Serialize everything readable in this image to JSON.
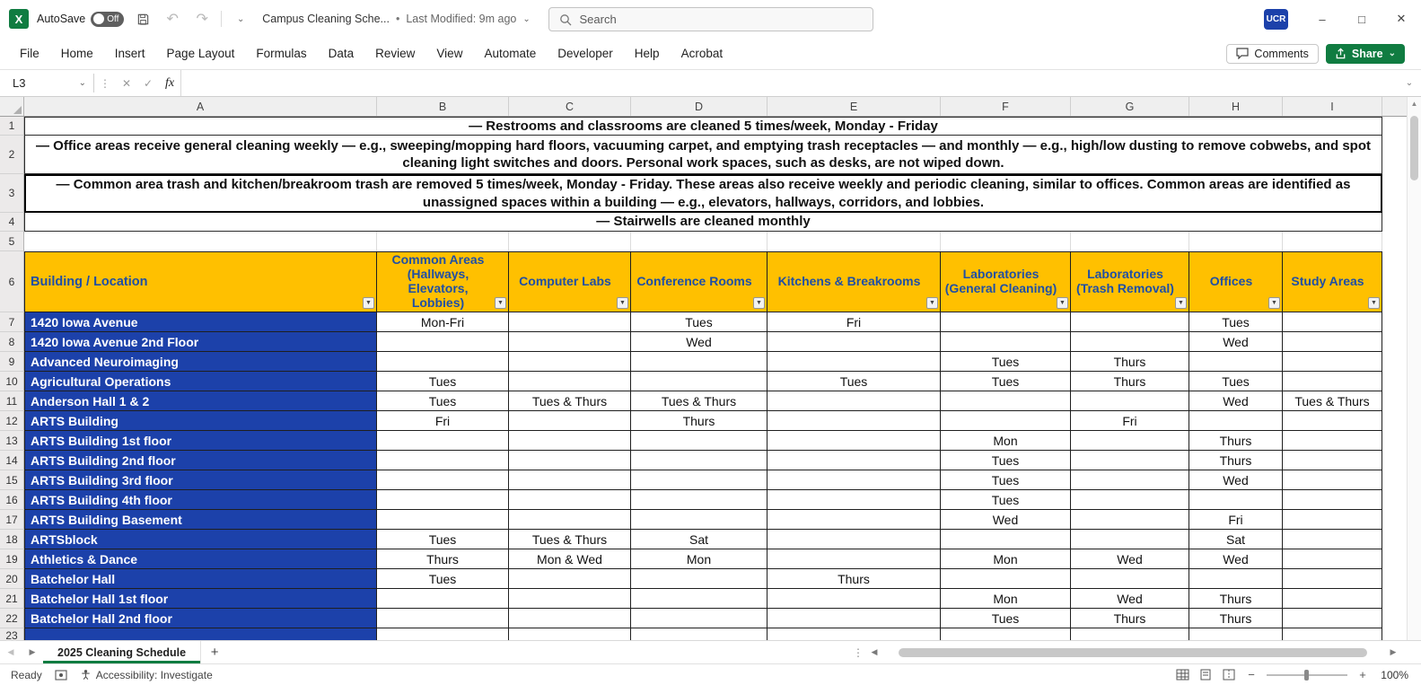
{
  "colors": {
    "accent_green": "#107C41",
    "header_bg": "#FFC000",
    "header_text": "#1F4FA5",
    "building_bg": "#1C41AA",
    "badge_bg": "#1C41AA",
    "grid_border": "#1f1f1f"
  },
  "titlebar": {
    "autosave_label": "AutoSave",
    "autosave_state": "Off",
    "doc_title": "Campus Cleaning Sche...",
    "last_modified": "Last Modified: 9m ago",
    "search_placeholder": "Search",
    "user_badge": "UCR"
  },
  "ribbon": {
    "tabs": [
      "File",
      "Home",
      "Insert",
      "Page Layout",
      "Formulas",
      "Data",
      "Review",
      "View",
      "Automate",
      "Developer",
      "Help",
      "Acrobat"
    ],
    "comments_label": "Comments",
    "share_label": "Share"
  },
  "formula_bar": {
    "name_box": "L3",
    "fx_label": "fx",
    "formula": ""
  },
  "sheet": {
    "columns": [
      "A",
      "B",
      "C",
      "D",
      "E",
      "F",
      "G",
      "H",
      "I"
    ],
    "notes": [
      "— Restrooms and classrooms are cleaned 5 times/week, Monday - Friday",
      "— Office areas receive general cleaning weekly — e.g., sweeping/mopping hard floors, vacuuming carpet, and emptying trash receptacles — and monthly — e.g., high/low dusting to remove cobwebs, and spot cleaning light switches and doors. Personal work spaces, such as desks, are not wiped down.",
      "— Common area trash and kitchen/breakroom trash are removed 5 times/week, Monday - Friday. These areas also receive weekly and periodic cleaning, similar to offices. Common areas are identified as unassigned spaces within a building — e.g., elevators, hallways, corridors, and lobbies.",
      "— Stairwells are cleaned monthly"
    ],
    "table": {
      "headers": [
        "Building / Location",
        "Common Areas (Hallways, Elevators, Lobbies)",
        "Computer Labs",
        "Conference Rooms",
        "Kitchens & Breakrooms",
        "Laboratories (General Cleaning)",
        "Laboratories (Trash Removal)",
        "Offices",
        "Study Areas"
      ],
      "rows": [
        {
          "name": "1420 Iowa Avenue",
          "values": [
            "Mon-Fri",
            "",
            "Tues",
            "Fri",
            "",
            "",
            "Tues",
            ""
          ]
        },
        {
          "name": "1420 Iowa Avenue 2nd Floor",
          "values": [
            "",
            "",
            "Wed",
            "",
            "",
            "",
            "Wed",
            ""
          ]
        },
        {
          "name": "Advanced Neuroimaging",
          "values": [
            "",
            "",
            "",
            "",
            "Tues",
            "Thurs",
            "",
            ""
          ]
        },
        {
          "name": "Agricultural Operations",
          "values": [
            "Tues",
            "",
            "",
            "Tues",
            "Tues",
            "Thurs",
            "Tues",
            ""
          ]
        },
        {
          "name": "Anderson Hall 1 & 2",
          "values": [
            "Tues",
            "Tues & Thurs",
            "Tues & Thurs",
            "",
            "",
            "",
            "Wed",
            "Tues & Thurs"
          ]
        },
        {
          "name": "ARTS Building",
          "values": [
            "Fri",
            "",
            "Thurs",
            "",
            "",
            "Fri",
            "",
            ""
          ]
        },
        {
          "name": "ARTS Building 1st floor",
          "values": [
            "",
            "",
            "",
            "",
            "Mon",
            "",
            "Thurs",
            ""
          ]
        },
        {
          "name": "ARTS Building 2nd floor",
          "values": [
            "",
            "",
            "",
            "",
            "Tues",
            "",
            "Thurs",
            ""
          ]
        },
        {
          "name": "ARTS Building 3rd floor",
          "values": [
            "",
            "",
            "",
            "",
            "Tues",
            "",
            "Wed",
            ""
          ]
        },
        {
          "name": "ARTS Building 4th floor",
          "values": [
            "",
            "",
            "",
            "",
            "Tues",
            "",
            "",
            ""
          ]
        },
        {
          "name": "ARTS Building Basement",
          "values": [
            "",
            "",
            "",
            "",
            "Wed",
            "",
            "Fri",
            ""
          ]
        },
        {
          "name": "ARTSblock",
          "values": [
            "Tues",
            "Tues & Thurs",
            "Sat",
            "",
            "",
            "",
            "Sat",
            ""
          ]
        },
        {
          "name": "Athletics & Dance",
          "values": [
            "Thurs",
            "Mon & Wed",
            "Mon",
            "",
            "Mon",
            "Wed",
            "Wed",
            ""
          ]
        },
        {
          "name": "Batchelor Hall",
          "values": [
            "Tues",
            "",
            "",
            "Thurs",
            "",
            "",
            "",
            ""
          ]
        },
        {
          "name": "Batchelor Hall 1st floor",
          "values": [
            "",
            "",
            "",
            "",
            "Mon",
            "Wed",
            "Thurs",
            ""
          ]
        },
        {
          "name": "Batchelor Hall 2nd floor",
          "values": [
            "",
            "",
            "",
            "",
            "Tues",
            "Thurs",
            "Thurs",
            ""
          ]
        }
      ]
    }
  },
  "sheet_tabs": {
    "active": "2025 Cleaning Schedule"
  },
  "status_bar": {
    "ready": "Ready",
    "accessibility": "Accessibility: Investigate",
    "zoom": "100%"
  }
}
